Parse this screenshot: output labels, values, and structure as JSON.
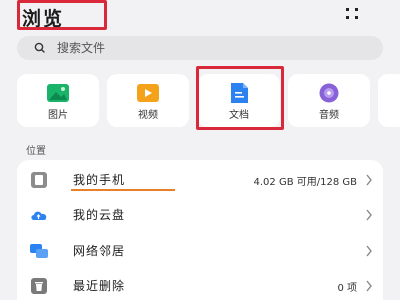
{
  "header": {
    "title": "浏览"
  },
  "search": {
    "placeholder": "搜索文件",
    "value": ""
  },
  "categories": [
    {
      "label": "图片",
      "color": "#19b36a",
      "icon": "image-icon"
    },
    {
      "label": "视频",
      "color": "#f5a21b",
      "icon": "video-icon"
    },
    {
      "label": "文档",
      "color": "#2c82f0",
      "icon": "document-icon"
    },
    {
      "label": "音频",
      "color": "#8a62d8",
      "icon": "audio-icon"
    }
  ],
  "locations": {
    "section_label": "位置",
    "items": [
      {
        "label": "我的手机",
        "value": "4.02 GB 可用/128 GB",
        "icon": "phone-icon"
      },
      {
        "label": "我的云盘",
        "value": "",
        "icon": "cloud-drive-icon"
      },
      {
        "label": "网络邻居",
        "value": "",
        "icon": "network-icon"
      },
      {
        "label": "最近删除",
        "value": "0 项",
        "icon": "trash-icon"
      }
    ]
  },
  "colors": {
    "highlight": "#d8283a",
    "underline": "#e8802a",
    "accent_blue": "#2c82f0"
  }
}
